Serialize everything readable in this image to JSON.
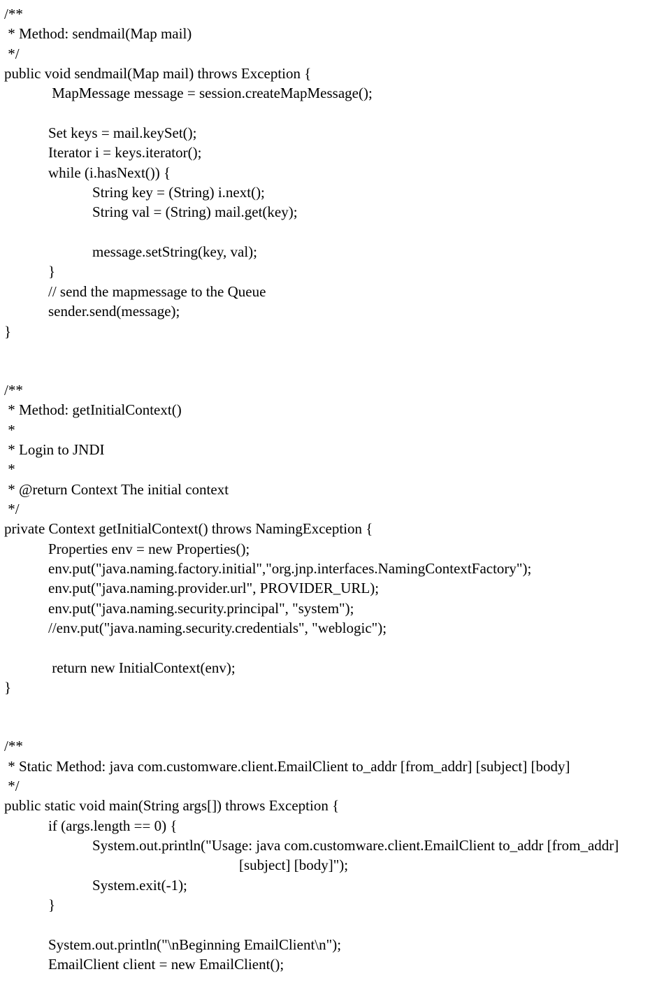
{
  "blocks": {
    "b1": "/**\n * Method: sendmail(Map mail)\n */\npublic void sendmail(Map mail) throws Exception {\n             MapMessage message = session.createMapMessage();\n\n            Set keys = mail.keySet();\n            Iterator i = keys.iterator();\n            while (i.hasNext()) {\n                        String key = (String) i.next();\n                        String val = (String) mail.get(key);\n\n                        message.setString(key, val);\n            }\n            // send the mapmessage to the Queue\n            sender.send(message);\n}",
    "b2": "/**\n * Method: getInitialContext()\n *\n * Login to JNDI\n *\n * @return Context The initial context\n */\nprivate Context getInitialContext() throws NamingException {\n            Properties env = new Properties();\n            env.put(\"java.naming.factory.initial\",\"org.jnp.interfaces.NamingContextFactory\");\n            env.put(\"java.naming.provider.url\", PROVIDER_URL);\n            env.put(\"java.naming.security.principal\", \"system\");\n            //env.put(\"java.naming.security.credentials\", \"weblogic\");\n\n             return new InitialContext(env);\n}",
    "b3": "/**\n * Static Method: java com.customware.client.EmailClient to_addr [from_addr] [subject] [body]\n */\npublic static void main(String args[]) throws Exception {\n            if (args.length == 0) {\n                        System.out.println(\"Usage: java com.customware.client.EmailClient to_addr [from_addr]\n                                                                [subject] [body]\");\n                        System.exit(-1);\n            }\n\n            System.out.println(\"\\nBeginning EmailClient\\n\");\n            EmailClient client = new EmailClient();"
  }
}
